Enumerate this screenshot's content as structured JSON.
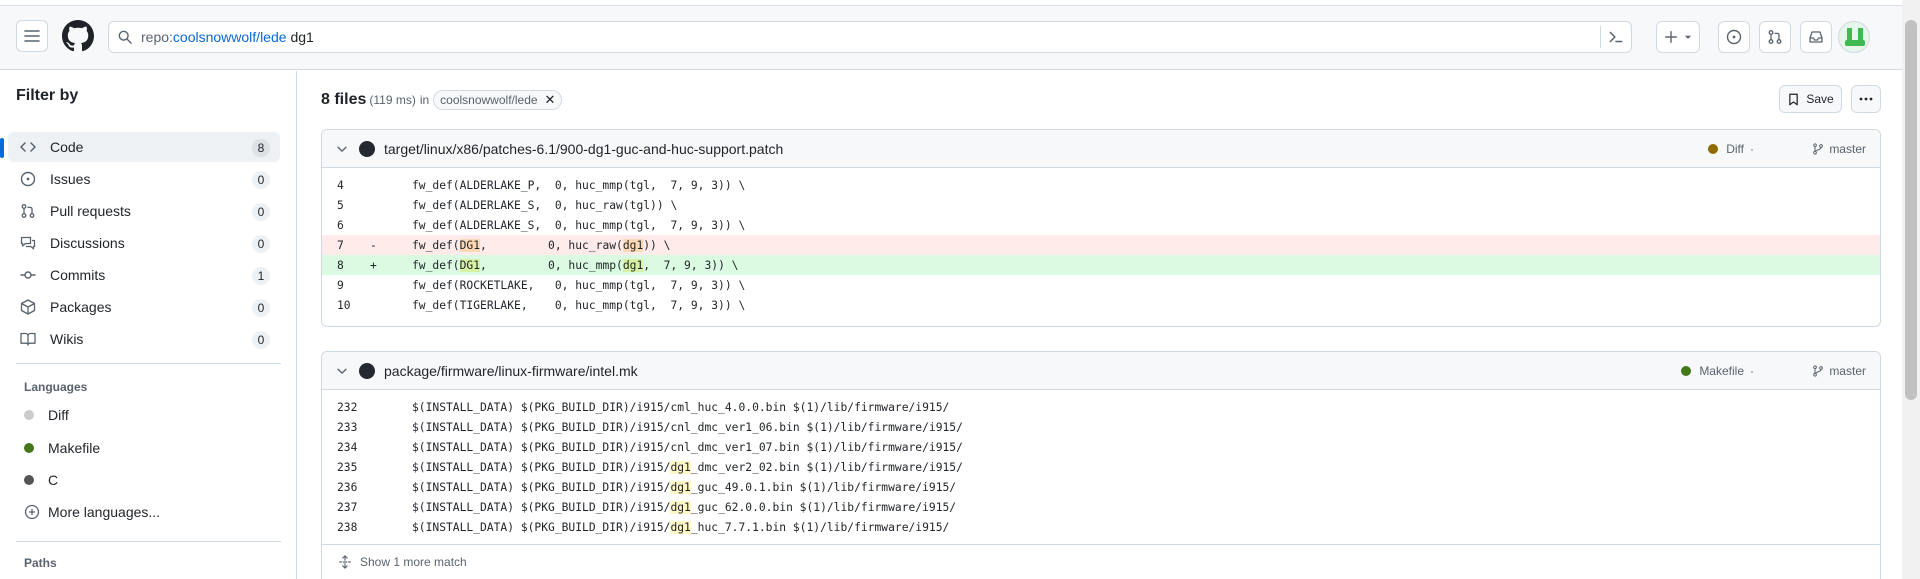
{
  "search": {
    "prefix": "repo:",
    "repo": "coolsnowwolf/lede",
    "term": "dg1"
  },
  "sidebar": {
    "title": "Filter by",
    "items": [
      {
        "label": "Code",
        "count": "8",
        "icon": "code-icon"
      },
      {
        "label": "Issues",
        "count": "0",
        "icon": "issue-icon"
      },
      {
        "label": "Pull requests",
        "count": "0",
        "icon": "pull-request-icon"
      },
      {
        "label": "Discussions",
        "count": "0",
        "icon": "discussion-icon"
      },
      {
        "label": "Commits",
        "count": "1",
        "icon": "commit-icon"
      },
      {
        "label": "Packages",
        "count": "0",
        "icon": "package-icon"
      },
      {
        "label": "Wikis",
        "count": "0",
        "icon": "book-icon"
      }
    ],
    "languages_heading": "Languages",
    "languages": [
      {
        "label": "Diff",
        "color": "#cccccc"
      },
      {
        "label": "Makefile",
        "color": "#427819"
      },
      {
        "label": "C",
        "color": "#555555"
      }
    ],
    "more_languages": "More languages...",
    "paths_heading": "Paths"
  },
  "results": {
    "count_label": "8 files",
    "time": "(119 ms)",
    "in_label": "in",
    "repo_chip": "coolsnowwolf/lede",
    "save_label": "Save"
  },
  "cards": [
    {
      "path": "target/linux/x86/patches-6.1/900-dg1-guc-and-huc-support.patch",
      "language": "Diff",
      "language_color": "#8f6a00",
      "branch": "master",
      "lines": [
        {
          "n": "4",
          "sign": "",
          "type": "",
          "parts": [
            {
              "t": "fw_def(ALDERLAKE_P,  0, huc_mmp(tgl,  7, 9, 3)) \\"
            }
          ]
        },
        {
          "n": "5",
          "sign": "",
          "type": "",
          "parts": [
            {
              "t": "fw_def(ALDERLAKE_S,  0, huc_raw(tgl)) \\"
            }
          ]
        },
        {
          "n": "6",
          "sign": "",
          "type": "",
          "parts": [
            {
              "t": "fw_def(ALDERLAKE_S,  0, huc_mmp(tgl,  7, 9, 3)) \\"
            }
          ]
        },
        {
          "n": "7",
          "sign": "-",
          "type": "del",
          "parts": [
            {
              "t": "fw_def("
            },
            {
              "t": "DG1",
              "m": true
            },
            {
              "t": ",         0, huc_raw("
            },
            {
              "t": "dg1",
              "m": true
            },
            {
              "t": ")) \\"
            }
          ]
        },
        {
          "n": "8",
          "sign": "+",
          "type": "add",
          "parts": [
            {
              "t": "fw_def("
            },
            {
              "t": "DG1",
              "m": true
            },
            {
              "t": ",         0, huc_mmp("
            },
            {
              "t": "dg1",
              "m": true
            },
            {
              "t": ",  7, 9, 3)) \\"
            }
          ]
        },
        {
          "n": "9",
          "sign": "",
          "type": "",
          "parts": [
            {
              "t": "fw_def(ROCKETLAKE,   0, huc_mmp(tgl,  7, 9, 3)) \\"
            }
          ]
        },
        {
          "n": "10",
          "sign": "",
          "type": "",
          "parts": [
            {
              "t": "fw_def(TIGERLAKE,    0, huc_mmp(tgl,  7, 9, 3)) \\"
            }
          ]
        }
      ]
    },
    {
      "path": "package/firmware/linux-firmware/intel.mk",
      "language": "Makefile",
      "language_color": "#427819",
      "branch": "master",
      "lines": [
        {
          "n": "232",
          "sign": "",
          "type": "",
          "parts": [
            {
              "t": "$(INSTALL_DATA) $(PKG_BUILD_DIR)/i915/cml_huc_4.0.0.bin $(1)/lib/firmware/i915/"
            }
          ]
        },
        {
          "n": "233",
          "sign": "",
          "type": "",
          "parts": [
            {
              "t": "$(INSTALL_DATA) $(PKG_BUILD_DIR)/i915/cnl_dmc_ver1_06.bin $(1)/lib/firmware/i915/"
            }
          ]
        },
        {
          "n": "234",
          "sign": "",
          "type": "",
          "parts": [
            {
              "t": "$(INSTALL_DATA) $(PKG_BUILD_DIR)/i915/cnl_dmc_ver1_07.bin $(1)/lib/firmware/i915/"
            }
          ]
        },
        {
          "n": "235",
          "sign": "",
          "type": "",
          "parts": [
            {
              "t": "$(INSTALL_DATA) $(PKG_BUILD_DIR)/i915/"
            },
            {
              "t": "dg1",
              "m": true
            },
            {
              "t": "_dmc_ver2_02.bin $(1)/lib/firmware/i915/"
            }
          ]
        },
        {
          "n": "236",
          "sign": "",
          "type": "",
          "parts": [
            {
              "t": "$(INSTALL_DATA) $(PKG_BUILD_DIR)/i915/"
            },
            {
              "t": "dg1",
              "m": true
            },
            {
              "t": "_guc_49.0.1.bin $(1)/lib/firmware/i915/"
            }
          ]
        },
        {
          "n": "237",
          "sign": "",
          "type": "",
          "parts": [
            {
              "t": "$(INSTALL_DATA) $(PKG_BUILD_DIR)/i915/"
            },
            {
              "t": "dg1",
              "m": true
            },
            {
              "t": "_guc_62.0.0.bin $(1)/lib/firmware/i915/"
            }
          ]
        },
        {
          "n": "238",
          "sign": "",
          "type": "",
          "parts": [
            {
              "t": "$(INSTALL_DATA) $(PKG_BUILD_DIR)/i915/"
            },
            {
              "t": "dg1",
              "m": true
            },
            {
              "t": "_huc_7.7.1.bin $(1)/lib/firmware/i915/"
            }
          ]
        }
      ],
      "show_more": "Show 1 more match"
    }
  ]
}
